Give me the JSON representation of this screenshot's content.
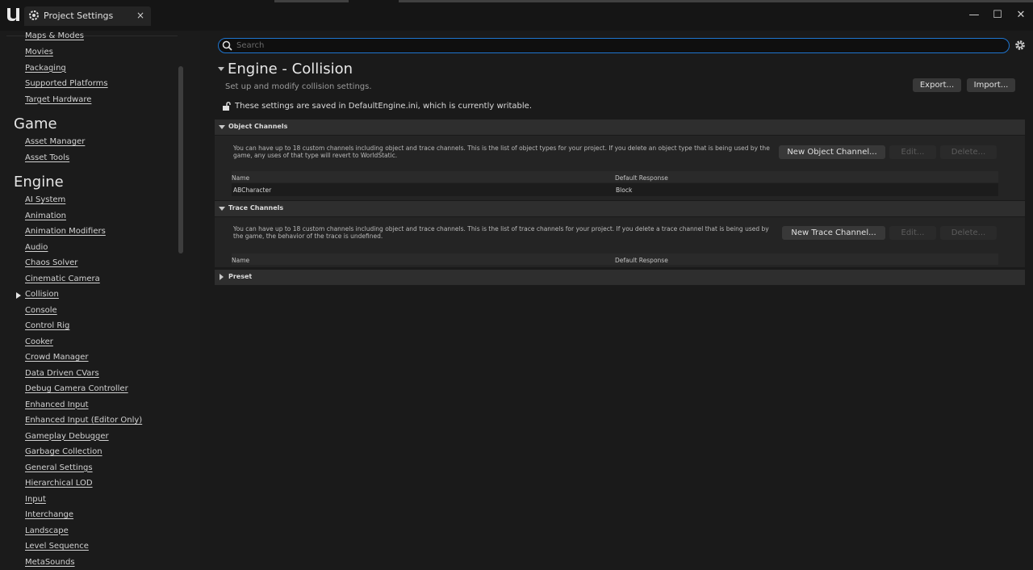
{
  "window": {
    "tab_title": "Project Settings",
    "close_glyph": "×",
    "minimize_glyph": "—",
    "maximize_glyph": "☐",
    "window_close_glyph": "✕"
  },
  "sidebar": {
    "partial_top_item": "Maps & Modes",
    "project_items": [
      "Movies",
      "Packaging",
      "Supported Platforms",
      "Target Hardware"
    ],
    "sections": [
      {
        "title": "Game",
        "items": [
          "Asset Manager",
          "Asset Tools"
        ]
      },
      {
        "title": "Engine",
        "items": [
          "AI System",
          "Animation",
          "Animation Modifiers",
          "Audio",
          "Chaos Solver",
          "Cinematic Camera",
          "Collision",
          "Console",
          "Control Rig",
          "Cooker",
          "Crowd Manager",
          "Data Driven CVars",
          "Debug Camera Controller",
          "Enhanced Input",
          "Enhanced Input (Editor Only)",
          "Gameplay Debugger",
          "Garbage Collection",
          "General Settings",
          "Hierarchical LOD",
          "Input",
          "Interchange",
          "Landscape",
          "Level Sequence",
          "MetaSounds"
        ]
      }
    ],
    "selected_item": "Collision"
  },
  "search": {
    "placeholder": "Search",
    "value": ""
  },
  "category": {
    "title": "Engine - Collision",
    "description": "Set up and modify collision settings.",
    "export_label": "Export...",
    "import_label": "Import...",
    "writable_note": "These settings are saved in DefaultEngine.ini, which is currently writable."
  },
  "object_channels": {
    "header": "Object Channels",
    "description": "You can have up to 18 custom channels including object and trace channels. This is the list of object types for your project. If you delete an object type that is being used by the game, any uses of that type will revert to WorldStatic.",
    "new_label": "New Object Channel...",
    "edit_label": "Edit...",
    "delete_label": "Delete...",
    "columns": [
      "Name",
      "Default Response"
    ],
    "rows": [
      [
        "ABCharacter",
        "Block"
      ]
    ]
  },
  "trace_channels": {
    "header": "Trace Channels",
    "description": "You can have up to 18 custom channels including object and trace channels. This is the list of trace channels for your project. If you delete a trace channel that is being used by the game, the behavior of the trace is undefined.",
    "new_label": "New Trace Channel...",
    "edit_label": "Edit...",
    "delete_label": "Delete...",
    "columns": [
      "Name",
      "Default Response"
    ]
  },
  "preset": {
    "header": "Preset"
  },
  "colors": {
    "accent": "#1f75cf",
    "background": "#1a1a1a",
    "panel": "#242424",
    "header": "#2e2e2e"
  },
  "icons": [
    "unreal-logo-icon",
    "settings-tab-icon",
    "search-icon",
    "gear-icon",
    "unlock-icon"
  ]
}
